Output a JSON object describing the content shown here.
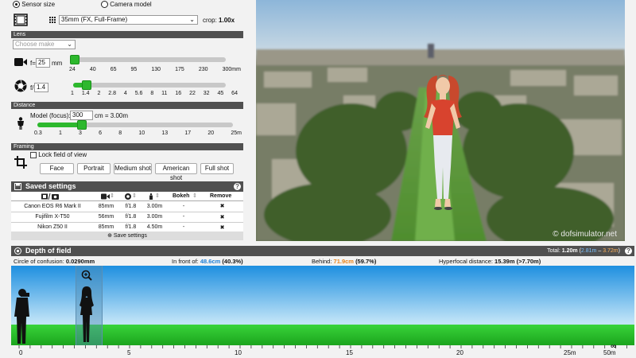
{
  "sensor": {
    "radio_sensor_size": "Sensor size",
    "radio_camera_model": "Camera model",
    "select_value": "35mm (FX, Full-Frame)",
    "crop_label": "crop:",
    "crop_value": "1.00x"
  },
  "lens": {
    "section_title": "Lens",
    "make_placeholder": "Choose make",
    "focal_prefix": "f=",
    "focal_value": "25",
    "focal_unit": "mm",
    "focal_ticks": [
      "24",
      "40",
      "65",
      "95",
      "130",
      "175",
      "230",
      "300mm"
    ],
    "focal_fraction": 0.0,
    "aperture_prefix": "f/",
    "aperture_value": "1.4",
    "aperture_ticks": [
      "1",
      "1.4",
      "2",
      "2.8",
      "4",
      "5.6",
      "8",
      "11",
      "16",
      "22",
      "32",
      "45",
      "64"
    ],
    "aperture_fraction": 0.083
  },
  "distance": {
    "section_title": "Distance",
    "model_label": "Model (focus):",
    "model_value": "300",
    "model_unit": "cm = 3.00m",
    "ticks": [
      "0.3",
      "1",
      "3",
      "6",
      "8",
      "10",
      "13",
      "17",
      "20",
      "25m"
    ],
    "fraction": 0.22
  },
  "framing": {
    "section_title": "Framing",
    "lock_label": "Lock field of view",
    "buttons": [
      "Face",
      "Portrait",
      "Medium shot",
      "American shot",
      "Full shot"
    ]
  },
  "saved": {
    "title": "Saved settings",
    "help": "?",
    "col_bokeh": "Bokeh",
    "col_remove": "Remove",
    "rows": [
      {
        "camera": "Canon EOS R6 Mark II",
        "focal": "85mm",
        "aperture": "f/1.8",
        "distance": "3.00m",
        "bokeh": "-",
        "remove": "✖"
      },
      {
        "camera": "Fujifilm X-T50",
        "focal": "56mm",
        "aperture": "f/1.8",
        "distance": "3.00m",
        "bokeh": "-",
        "remove": "✖"
      },
      {
        "camera": "Nikon Z50 II",
        "focal": "85mm",
        "aperture": "f/1.8",
        "distance": "4.50m",
        "bokeh": "-",
        "remove": "✖"
      }
    ],
    "save_button": "Save settings"
  },
  "preview": {
    "watermark": "© dofsimulator.net"
  },
  "dof": {
    "title": "Depth of field",
    "total_label": "Total:",
    "total_value": "1.20m",
    "total_range_open": "(",
    "total_near": "2.81m",
    "total_dash": " – ",
    "total_far": "3.72m",
    "total_range_close": ")",
    "help": "?",
    "coc_label": "Circle of confusion:",
    "coc_value": "0.0290mm",
    "front_label": "In front of:",
    "front_value": "48.6cm",
    "front_pct": "(40.3%)",
    "behind_label": "Behind:",
    "behind_value": "71.9cm",
    "behind_pct": "(59.7%)",
    "hyper_label": "Hyperfocal distance:",
    "hyper_value": "15.39m (>7.70m)",
    "scale_labels": [
      "0",
      "5",
      "10",
      "15",
      "20",
      "25m",
      "50m",
      "∞"
    ],
    "colors": {
      "near": "#1e7fd6",
      "far": "#e8831a",
      "accent": "#2db82d",
      "header": "#505050"
    }
  }
}
